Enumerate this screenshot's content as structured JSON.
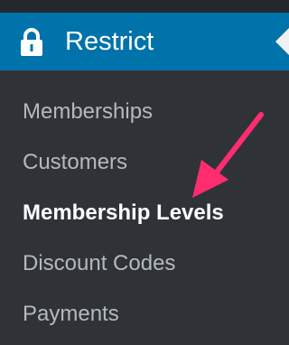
{
  "menu": {
    "title": "Restrict",
    "icon": "lock-icon",
    "accent_color": "#0073aa",
    "items": [
      {
        "label": "Memberships",
        "current": false
      },
      {
        "label": "Customers",
        "current": false
      },
      {
        "label": "Membership Levels",
        "current": true
      },
      {
        "label": "Discount Codes",
        "current": false
      },
      {
        "label": "Payments",
        "current": false
      }
    ]
  },
  "annotation": {
    "icon": "arrow-icon",
    "color": "#ff2d6f"
  }
}
